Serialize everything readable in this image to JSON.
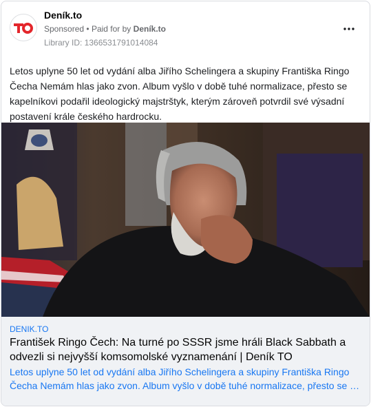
{
  "ad": {
    "page_name": "Deník.to",
    "sponsored": "Sponsored",
    "paid_for_by_prefix": "Paid for by",
    "paid_for_by_page": "Deník.to",
    "separator": "•",
    "library_id": "Library ID: 1366531791014084",
    "more_icon": "more-horizontal-icon",
    "body_text": "Letos uplyne 50 let od vydání alba Jiřího Schelingera a skupiny Františka Ringo Čecha Nemám hlas jako zvon. Album vyšlo v době tuhé normalizace, přesto se kapelníkovi podařil ideologický majstrštyk, kterým zároveň potvrdil své výsadní postavení krále českého hardrocku."
  },
  "link": {
    "domain": "DENIK.TO",
    "headline": "František Ringo Čech: Na turné po SSSR jsme hráli Black Sabbath a odvezli si nejvyšší komsomolské vyznamenání | Deník TO",
    "description_line1": "Letos uplyne 50 let od vydání alba Jiřího Schelingera a skupiny Františka Ringo",
    "description_line2": "Čecha Nemám hlas jako zvon. Album vyšlo v době tuhé normalizace, přesto se kapelníkovi podařil ideologický majstrštyk"
  },
  "colors": {
    "logo_red": "#e3262b",
    "link_blue": "#1877f2",
    "link_bg": "#f0f2f5",
    "text_grey": "#65676b"
  }
}
